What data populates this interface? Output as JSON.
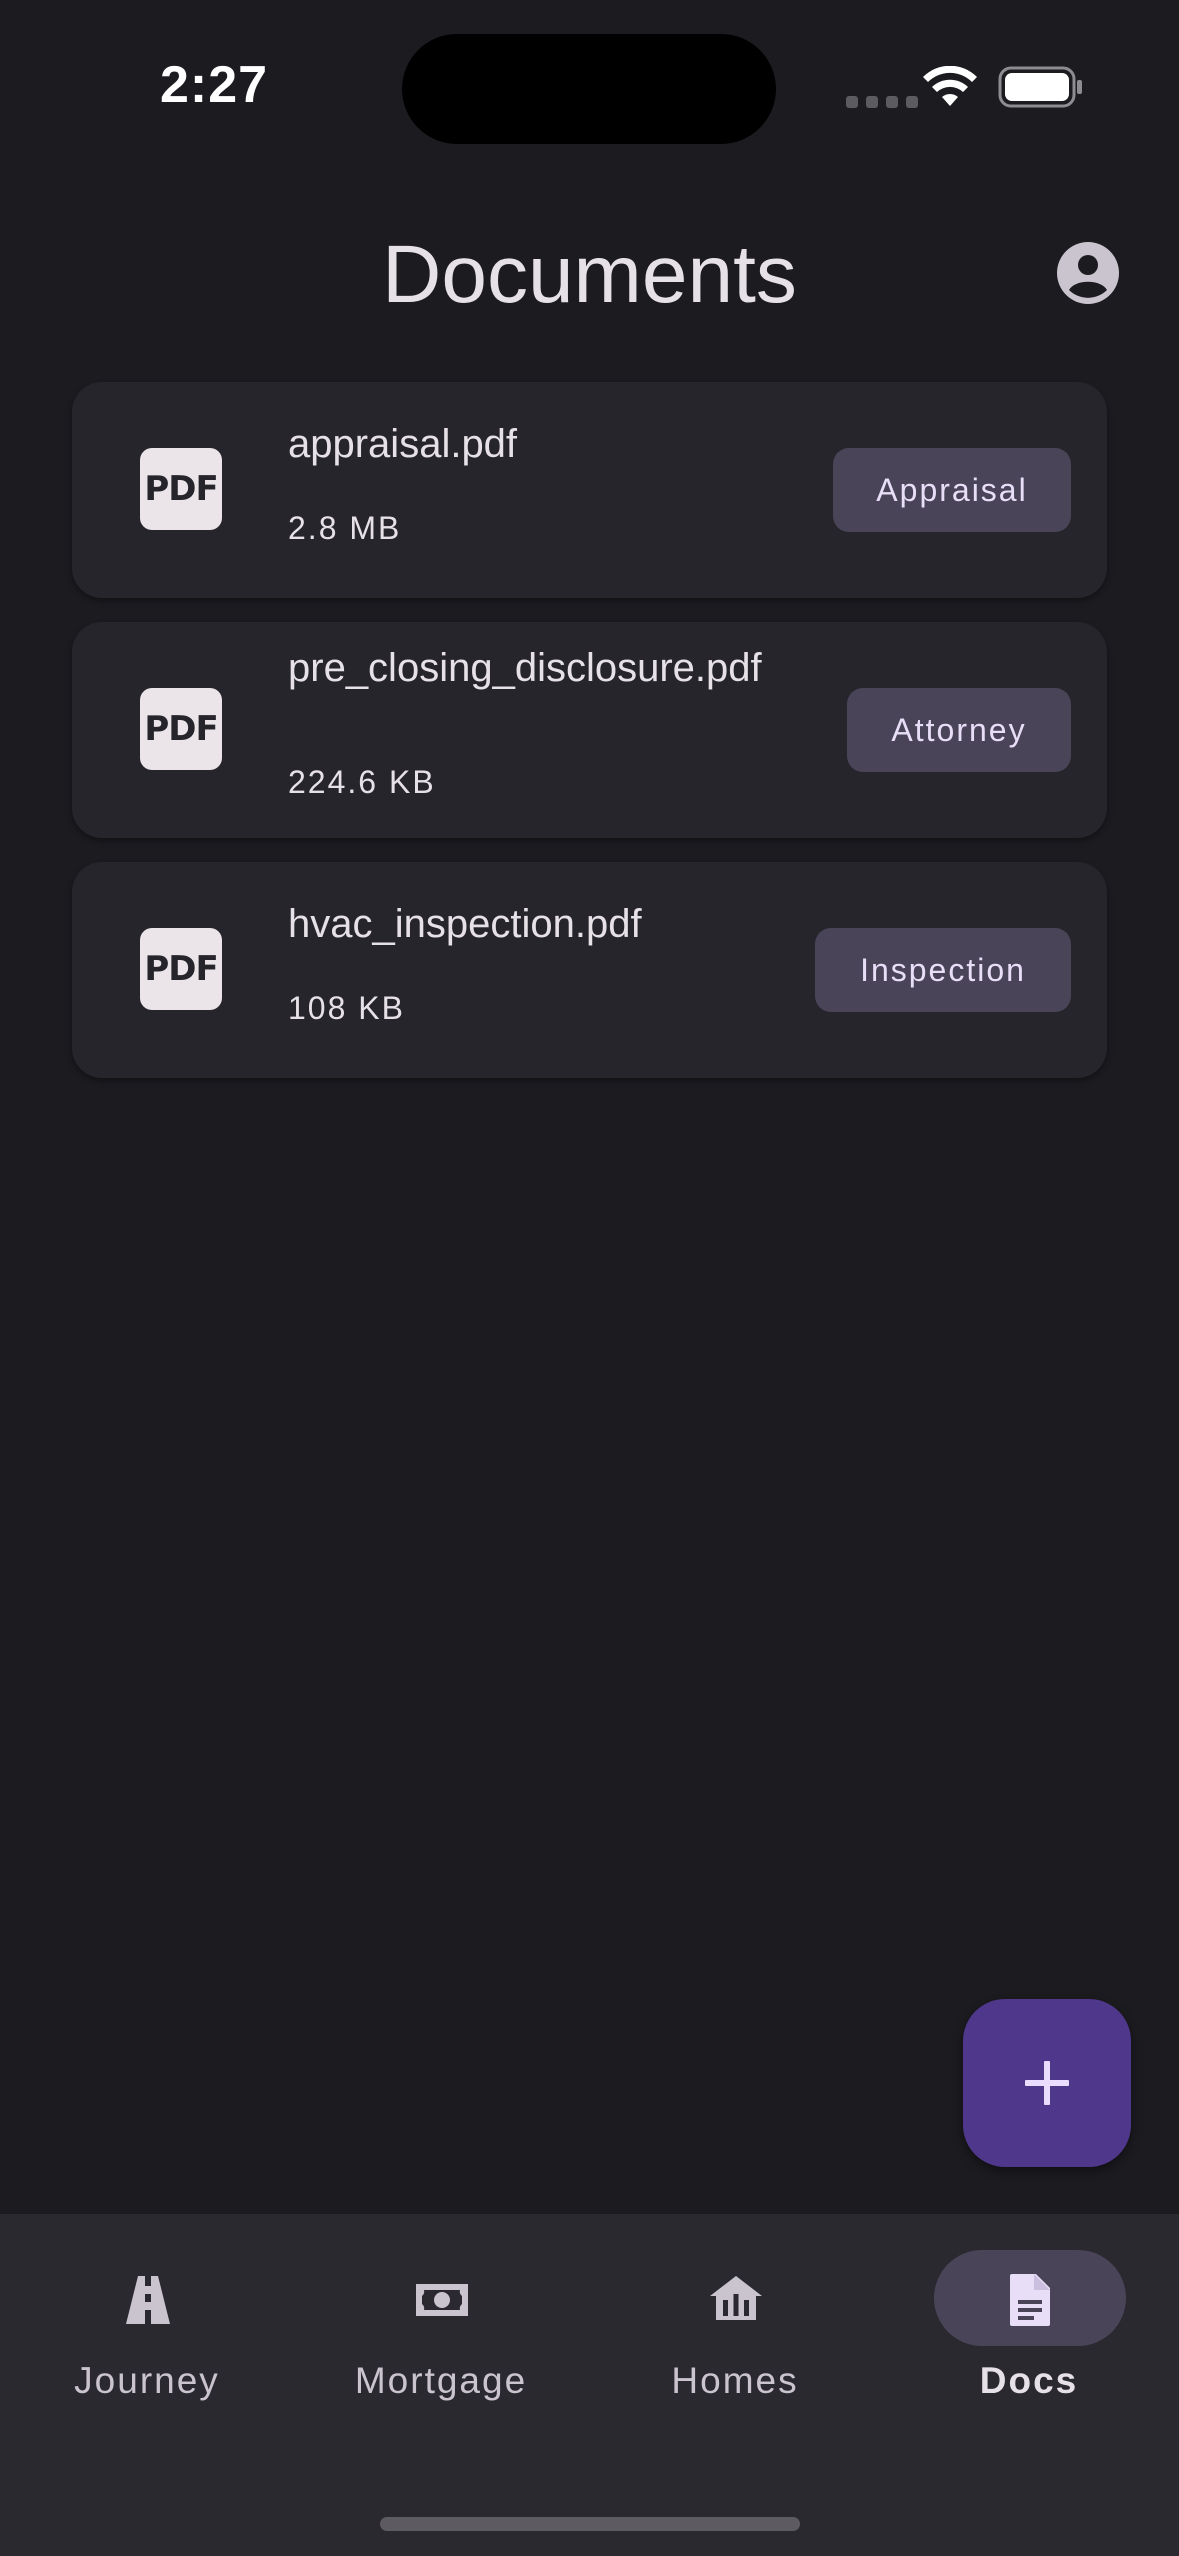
{
  "status_bar": {
    "time": "2:27"
  },
  "header": {
    "title": "Documents",
    "account_icon": "account-circle-icon"
  },
  "documents": [
    {
      "name": "appraisal.pdf",
      "size": "2.8 MB",
      "tag": "Appraisal",
      "icon": "pdf-icon",
      "icon_text": "PDF"
    },
    {
      "name": "pre_closing_disclosure.pdf",
      "size": "224.6 KB",
      "tag": "Attorney",
      "icon": "pdf-icon",
      "icon_text": "PDF"
    },
    {
      "name": "hvac_inspection.pdf",
      "size": "108 KB",
      "tag": "Inspection",
      "icon": "pdf-icon",
      "icon_text": "PDF"
    }
  ],
  "fab": {
    "icon": "plus-icon"
  },
  "nav": {
    "items": [
      {
        "label": "Journey",
        "icon": "road-icon",
        "active": false
      },
      {
        "label": "Mortgage",
        "icon": "money-icon",
        "active": false
      },
      {
        "label": "Homes",
        "icon": "home-icon",
        "active": false
      },
      {
        "label": "Docs",
        "icon": "document-icon",
        "active": true
      }
    ]
  },
  "colors": {
    "background": "#1c1b20",
    "card": "#26252b",
    "tag": "#4a4458",
    "fab": "#4f378b",
    "nav": "#2b2930"
  }
}
